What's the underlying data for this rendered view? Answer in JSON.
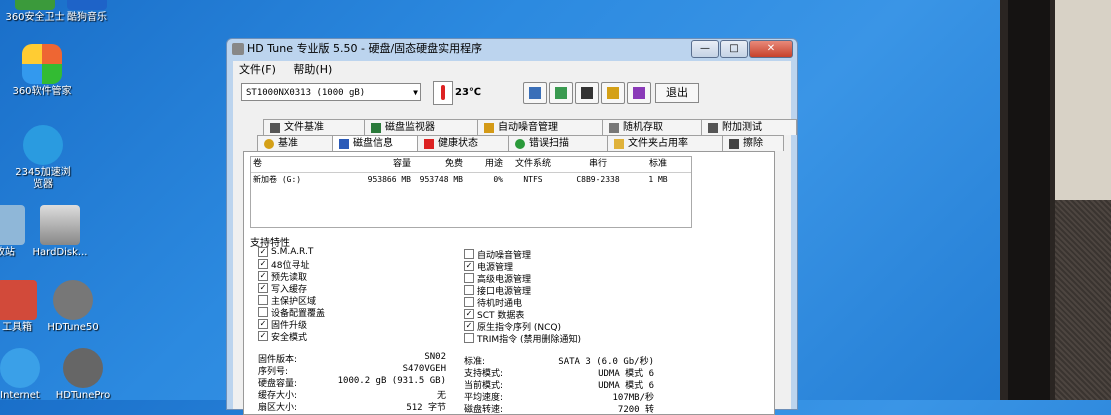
{
  "desktop": {
    "icons": [
      {
        "label": "360安全卫士"
      },
      {
        "label": "酷狗音乐"
      },
      {
        "label": "360软件管家"
      },
      {
        "label": "2345加速浏览器"
      },
      {
        "label": "收站"
      },
      {
        "label": "HardDisk..."
      },
      {
        "label": "工具箱"
      },
      {
        "label": "HDTune50"
      },
      {
        "label": "Internet"
      },
      {
        "label": "HDTunePro"
      }
    ]
  },
  "window": {
    "title": "HD Tune 专业版 5.50 - 硬盘/固态硬盘实用程序",
    "menu": [
      "文件(F)",
      "帮助(H)"
    ],
    "drive": "ST1000NX0313 (1000 gB)",
    "temperature": "23℃",
    "exit_label": "退出",
    "tabs_row1": [
      "文件基准",
      "磁盘监视器",
      "自动噪音管理",
      "随机存取",
      "附加测试"
    ],
    "tabs_row2": [
      "基准",
      "磁盘信息",
      "健康状态",
      "错误扫描",
      "文件夹占用率",
      "擦除"
    ],
    "active_tab": "磁盘信息",
    "volume_headers": [
      "卷",
      "容量",
      "免费",
      "用途",
      "文件系统",
      "串行",
      "标准"
    ],
    "volume_rows": [
      [
        "新加卷 (G:)",
        "953866 MB",
        "953748 MB",
        "0%",
        "NTFS",
        "C8B9-2338",
        "1 MB"
      ]
    ],
    "features_label": "支持特性",
    "features_left": [
      {
        "label": "S.M.A.R.T",
        "checked": true
      },
      {
        "label": "48位寻址",
        "checked": true
      },
      {
        "label": "预先读取",
        "checked": true
      },
      {
        "label": "写入缓存",
        "checked": true
      },
      {
        "label": "主保护区域",
        "checked": false
      },
      {
        "label": "设备配置覆盖",
        "checked": false
      },
      {
        "label": "固件升级",
        "checked": true
      },
      {
        "label": "安全模式",
        "checked": true
      }
    ],
    "features_right": [
      {
        "label": "自动噪音管理",
        "checked": false
      },
      {
        "label": "电源管理",
        "checked": true
      },
      {
        "label": "高级电源管理",
        "checked": false
      },
      {
        "label": "接口电源管理",
        "checked": false
      },
      {
        "label": "待机时通电",
        "checked": false
      },
      {
        "label": "SCT 数据表",
        "checked": true
      },
      {
        "label": "原生指令序列 (NCQ)",
        "checked": true
      },
      {
        "label": "TRIM指令 (禁用删除通知)",
        "checked": false
      }
    ],
    "info_left": [
      {
        "label": "固件版本:",
        "value": "SN02"
      },
      {
        "label": "序列号:",
        "value": "S470VGEH"
      },
      {
        "label": "硬盘容量:",
        "value": "1000.2 gB (931.5 GB)"
      },
      {
        "label": "缓存大小:",
        "value": "无"
      },
      {
        "label": "扇区大小:",
        "value": "512 字节"
      }
    ],
    "info_right": [
      {
        "label": "标准:",
        "value": "SATA 3 (6.0 Gb/秒)"
      },
      {
        "label": "支持模式:",
        "value": "UDMA 模式 6"
      },
      {
        "label": "当前模式:",
        "value": "UDMA 模式 6"
      },
      {
        "label": "平均速度:",
        "value": "107MB/秒"
      },
      {
        "label": "磁盘转速:",
        "value": "7200 转"
      }
    ]
  }
}
